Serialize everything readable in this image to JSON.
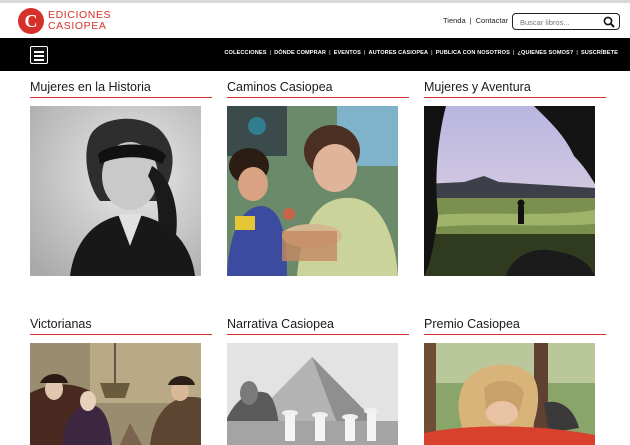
{
  "brand": {
    "mark": "C",
    "line1": "EDICIONES",
    "line2": "CASIOPEA",
    "color": "#d6302b"
  },
  "top_links": {
    "store": "Tienda",
    "separator": "|",
    "contact": "Contactar"
  },
  "search": {
    "placeholder": "Buscar libros..."
  },
  "nav": {
    "items": [
      "COLECCIONES",
      "DÓNDE COMPRAR",
      "EVENTOS",
      "AUTORES CASIOPEA",
      "PUBLICA CON NOSOTROS",
      "¿QUIENES SOMOS?",
      "SUSCRÍBETE"
    ],
    "separator": "|"
  },
  "collections": [
    {
      "title": "Mujeres en la Historia",
      "image": "portrait-woman-bw"
    },
    {
      "title": "Caminos Casiopea",
      "image": "women-crafting-photo"
    },
    {
      "title": "Mujeres y Aventura",
      "image": "coastal-cave-landscape"
    },
    {
      "title": "Victorianas",
      "image": "victorian-painting"
    },
    {
      "title": "Narrativa Casiopea",
      "image": "pyramids-sphinx-bw"
    },
    {
      "title": "Premio Casiopea",
      "image": "woman-reading-hammock"
    }
  ]
}
